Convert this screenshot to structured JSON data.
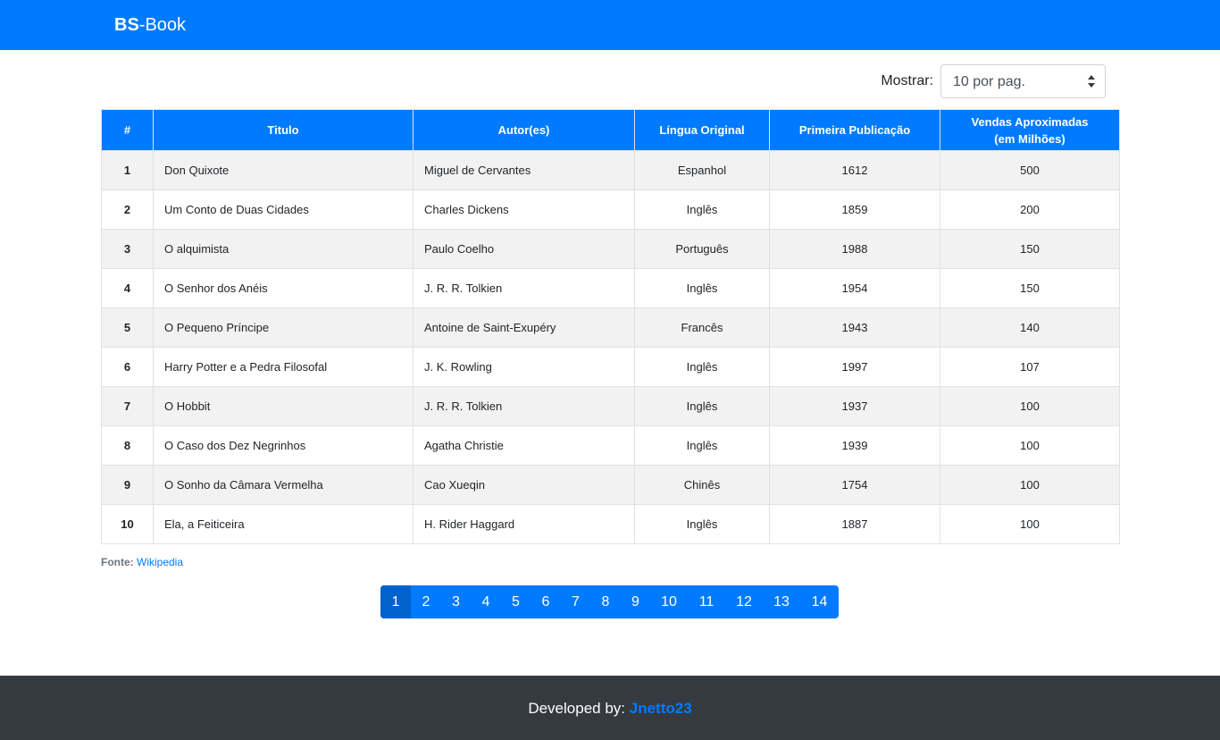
{
  "navbar": {
    "brand_bold": "BS",
    "brand_rest": "-Book"
  },
  "controls": {
    "show_label": "Mostrar:",
    "per_page_value": "10 por pag."
  },
  "table": {
    "headers": [
      "#",
      "Titulo",
      "Autor(es)",
      "Língua Original",
      "Primeira Publicação",
      "Vendas Aproximadas",
      "(em Milhões)"
    ],
    "rows": [
      {
        "num": "1",
        "title": "Don Quixote",
        "author": "Miguel de Cervantes",
        "language": "Espanhol",
        "year": "1612",
        "sales": "500"
      },
      {
        "num": "2",
        "title": "Um Conto de Duas Cidades",
        "author": "Charles Dickens",
        "language": "Inglês",
        "year": "1859",
        "sales": "200"
      },
      {
        "num": "3",
        "title": "O alquimista",
        "author": "Paulo Coelho",
        "language": "Português",
        "year": "1988",
        "sales": "150"
      },
      {
        "num": "4",
        "title": "O Senhor dos Anéis",
        "author": "J. R. R. Tolkien",
        "language": "Inglês",
        "year": "1954",
        "sales": "150"
      },
      {
        "num": "5",
        "title": "O Pequeno Príncipe",
        "author": "Antoine de Saint-Exupéry",
        "language": "Francês",
        "year": "1943",
        "sales": "140"
      },
      {
        "num": "6",
        "title": "Harry Potter e a Pedra Filosofal",
        "author": "J. K. Rowling",
        "language": "Inglês",
        "year": "1997",
        "sales": "107"
      },
      {
        "num": "7",
        "title": "O Hobbit",
        "author": "J. R. R. Tolkien",
        "language": "Inglês",
        "year": "1937",
        "sales": "100"
      },
      {
        "num": "8",
        "title": "O Caso dos Dez Negrinhos",
        "author": "Agatha Christie",
        "language": "Inglês",
        "year": "1939",
        "sales": "100"
      },
      {
        "num": "9",
        "title": "O Sonho da Câmara Vermelha",
        "author": "Cao Xueqin",
        "language": "Chinês",
        "year": "1754",
        "sales": "100"
      },
      {
        "num": "10",
        "title": "Ela, a Feiticeira",
        "author": "H. Rider Haggard",
        "language": "Inglês",
        "year": "1887",
        "sales": "100"
      }
    ]
  },
  "source": {
    "label": "Fonte:",
    "link_text": "Wikipedia"
  },
  "pagination": {
    "pages": [
      "1",
      "2",
      "3",
      "4",
      "5",
      "6",
      "7",
      "8",
      "9",
      "10",
      "11",
      "12",
      "13",
      "14"
    ],
    "active": "1"
  },
  "footer": {
    "prefix": "Developed by:",
    "author": "Jnetto23"
  },
  "colors": {
    "primary": "#007bff",
    "active_page": "#0062cc",
    "footer_bg": "#343a40",
    "stripe": "#f2f2f2"
  }
}
